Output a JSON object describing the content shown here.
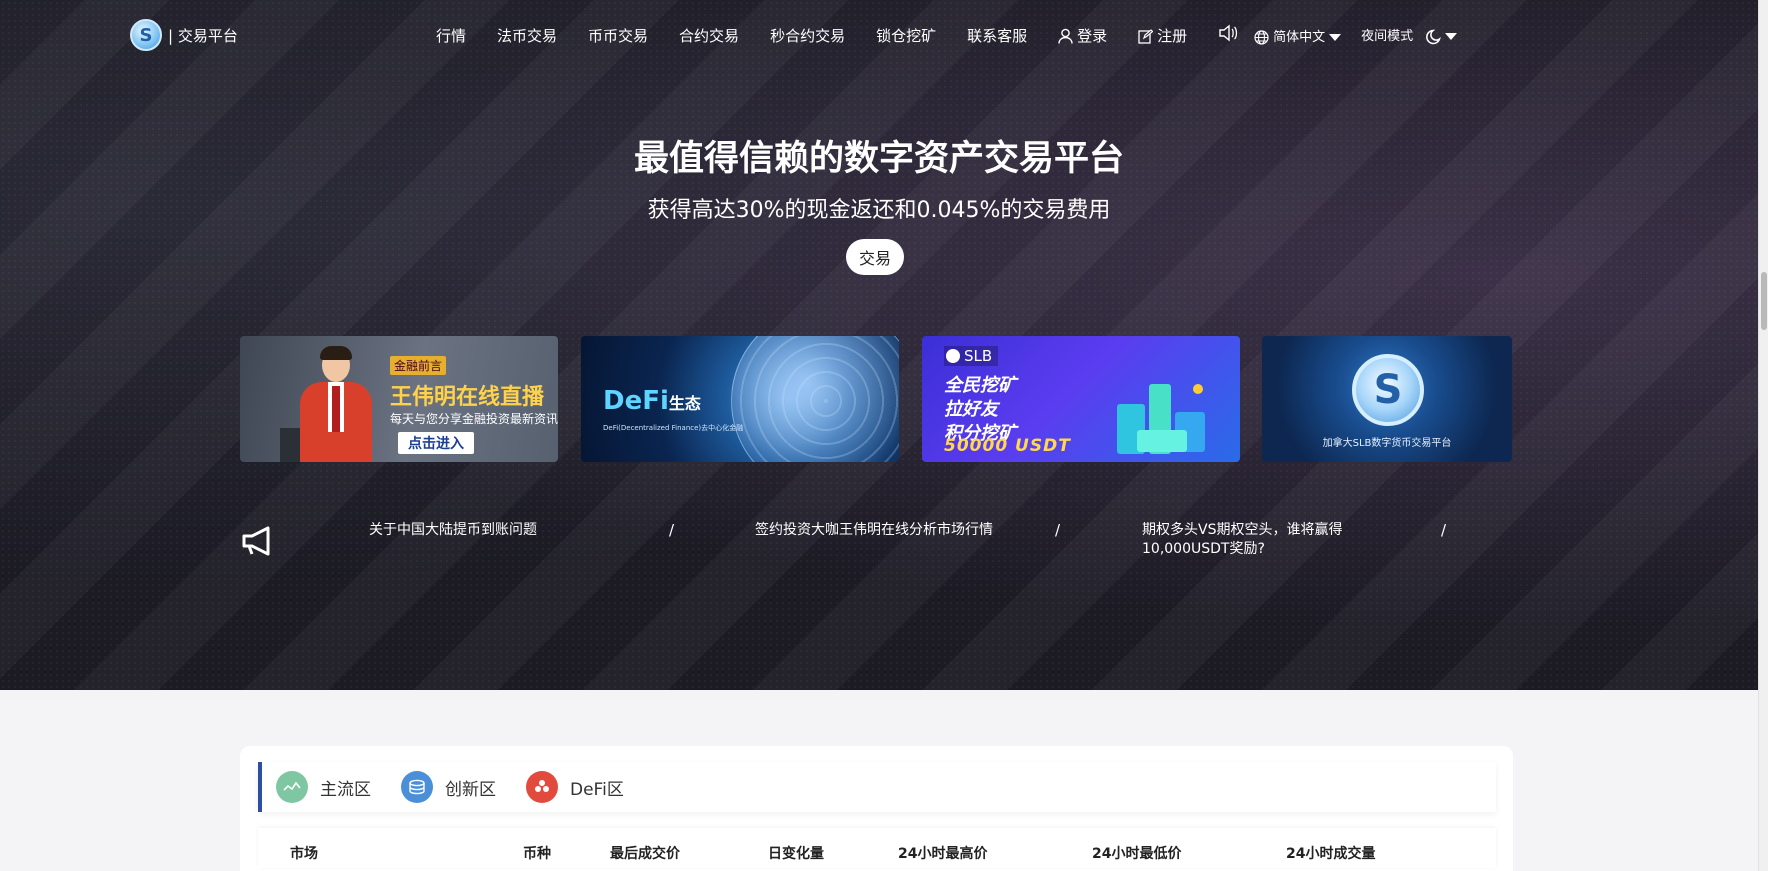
{
  "nav": {
    "logo_glyph": "S",
    "brand": "| 交易平台",
    "menu": [
      "行情",
      "法币交易",
      "币币交易",
      "合约交易",
      "秒合约交易",
      "锁仓挖矿",
      "联系客服"
    ],
    "login": "登录",
    "register": "注册",
    "language": "简体中文",
    "night_mode": "夜间模式"
  },
  "hero": {
    "headline": "最值得信赖的数字资产交易平台",
    "subline": "获得高达30%的现金返还和0.045%的交易费用",
    "trade_button": "交易"
  },
  "banners": {
    "b1": {
      "tag": "金融前言",
      "title": "王伟明在线直播",
      "subtitle": "每天与您分享金融投资最新资讯",
      "button": "点击进入"
    },
    "b2": {
      "title": "DeFi",
      "title_suffix": "生态",
      "small": "DeFi(Decentralized Finance)去中心化金融"
    },
    "b3": {
      "badge": "SLB",
      "lines": [
        "全民挖矿",
        "拉好友",
        "积分挖矿"
      ],
      "amount": "50000 USDT"
    },
    "b4": {
      "coin_glyph": "S",
      "text": "加拿大SLB数字货币交易平台"
    }
  },
  "notices": [
    "关于中国大陆提币到账问题",
    "签约投资大咖王伟明在线分析市场行情",
    "期权多头VS期权空头，谁将赢得10,000USDT奖励?"
  ],
  "notice_separator": "/",
  "market": {
    "tabs": [
      {
        "label": "主流区",
        "icon": "wave-chart-icon",
        "color": "#7fc7a3"
      },
      {
        "label": "创新区",
        "icon": "coin-stack-icon",
        "color": "#4a8fd8"
      },
      {
        "label": "DeFi区",
        "icon": "defi-flower-icon",
        "color": "#e24a3d"
      }
    ],
    "columns": [
      "市场",
      "币种",
      "最后成交价",
      "日变化量",
      "24小时最高价",
      "24小时最低价",
      "24小时成交量"
    ]
  },
  "colors": {
    "hero_bg": "#1c1b24",
    "tab_accent": "#2c4fa3",
    "banner_gold": "#ffd24a"
  }
}
